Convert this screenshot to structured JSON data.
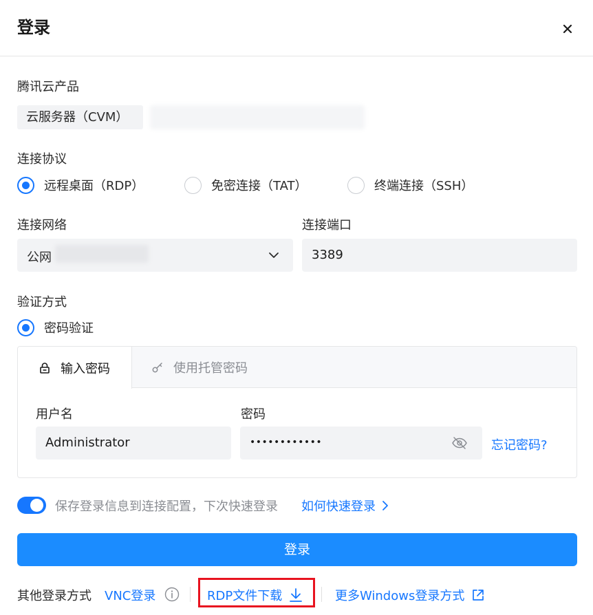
{
  "dialog": {
    "title": "登录",
    "close_icon": "close-icon"
  },
  "product": {
    "label": "腾讯云产品",
    "tag": "云服务器（CVM）"
  },
  "protocol": {
    "label": "连接协议",
    "options": [
      {
        "label": "远程桌面（RDP）",
        "checked": true
      },
      {
        "label": "免密连接（TAT）",
        "checked": false
      },
      {
        "label": "终端连接（SSH）",
        "checked": false
      }
    ]
  },
  "network": {
    "label": "连接网络",
    "value": "公网"
  },
  "port": {
    "label": "连接端口",
    "value": "3389"
  },
  "auth": {
    "label": "验证方式",
    "option": "密码验证",
    "tabs": [
      {
        "label": "输入密码",
        "icon": "lock-icon",
        "active": true
      },
      {
        "label": "使用托管密码",
        "icon": "key-icon",
        "active": false
      }
    ],
    "username_label": "用户名",
    "username_value": "Administrator",
    "password_label": "密码",
    "password_value": "••••••••••••",
    "forgot_link": "忘记密码?"
  },
  "save": {
    "enabled": true,
    "text": "保存登录信息到连接配置，下次快速登录",
    "link": "如何快速登录"
  },
  "login_button": "登录",
  "other": {
    "label": "其他登录方式",
    "vnc": "VNC登录",
    "rdp_download": "RDP文件下载",
    "more_windows": "更多Windows登录方式"
  },
  "colors": {
    "accent": "#1677ff",
    "button": "#1b8cff",
    "highlight_box": "#e8131f"
  }
}
